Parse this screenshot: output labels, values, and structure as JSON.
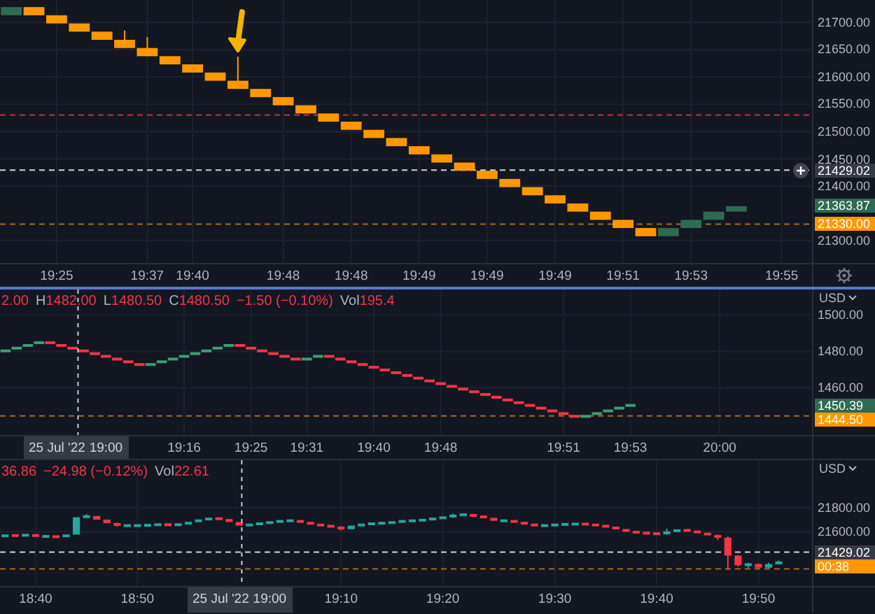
{
  "panes": [
    {
      "settings_button": true,
      "price_tags": [
        {
          "label": "21429.02",
          "color": "#363a45",
          "button": true
        },
        {
          "label": "21363.87",
          "color": "#2e6b52"
        },
        {
          "label": "21330.00",
          "color": "#ff9800"
        }
      ],
      "arrow": true,
      "chart_data": {
        "type": "candlestick",
        "grid": true,
        "ylim": [
          21259,
          21741
        ],
        "yticks": [
          {
            "value": 21700,
            "label": "21700.00"
          },
          {
            "value": 21650,
            "label": "21650.00"
          },
          {
            "value": 21600,
            "label": "21600.00"
          },
          {
            "value": 21550,
            "label": "21550.00"
          },
          {
            "value": 21500,
            "label": "21500.00"
          },
          {
            "value": 21450,
            "label": "21450.00"
          },
          {
            "value": 21400,
            "label": "21400.00"
          },
          {
            "value": 21300,
            "label": "21300.00"
          }
        ],
        "categories": [
          null,
          null,
          "19:25",
          null,
          null,
          null,
          "19:37",
          null,
          "19:40",
          null,
          null,
          null,
          "19:48",
          null,
          null,
          "19:48",
          null,
          null,
          "19:49",
          null,
          null,
          "19:49",
          null,
          null,
          "19:49",
          null,
          null,
          "19:51",
          null,
          null,
          "19:53",
          null,
          null,
          null,
          "19:55"
        ],
        "ohlc": [
          [
            21713,
            21728,
            21713,
            21728
          ],
          [
            21728,
            21728,
            21713,
            21713
          ],
          [
            21713,
            21713,
            21698,
            21698
          ],
          [
            21698,
            21698,
            21683,
            21683
          ],
          [
            21683,
            21683,
            21668,
            21668
          ],
          [
            21668,
            21685,
            21653,
            21653
          ],
          [
            21653,
            21673,
            21638,
            21638
          ],
          [
            21638,
            21638,
            21623,
            21623
          ],
          [
            21623,
            21623,
            21608,
            21608
          ],
          [
            21608,
            21608,
            21593,
            21593
          ],
          [
            21593,
            21637,
            21578,
            21578
          ],
          [
            21578,
            21578,
            21563,
            21563
          ],
          [
            21563,
            21563,
            21548,
            21548
          ],
          [
            21548,
            21548,
            21533,
            21533
          ],
          [
            21533,
            21533,
            21518,
            21518
          ],
          [
            21518,
            21518,
            21503,
            21503
          ],
          [
            21503,
            21503,
            21488,
            21488
          ],
          [
            21488,
            21488,
            21473,
            21473
          ],
          [
            21473,
            21473,
            21458,
            21458
          ],
          [
            21458,
            21458,
            21443,
            21443
          ],
          [
            21443,
            21443,
            21428,
            21428
          ],
          [
            21428,
            21428,
            21413,
            21413
          ],
          [
            21413,
            21413,
            21398,
            21398
          ],
          [
            21398,
            21398,
            21383,
            21383
          ],
          [
            21383,
            21383,
            21368,
            21368
          ],
          [
            21368,
            21368,
            21353,
            21353
          ],
          [
            21353,
            21353,
            21338,
            21338
          ],
          [
            21338,
            21338,
            21323,
            21323
          ],
          [
            21323,
            21323,
            21308,
            21308
          ],
          [
            21308,
            21323,
            21308,
            21323
          ],
          [
            21323,
            21338,
            21323,
            21338
          ],
          [
            21338,
            21353,
            21338,
            21353
          ],
          [
            21353,
            21363,
            21353,
            21363
          ],
          null,
          null
        ],
        "ref_lines": [
          {
            "axis": "y",
            "value": 21530,
            "color": "#b33a3a"
          },
          {
            "axis": "y",
            "value": 21429.02,
            "color": "#d1d4dc"
          },
          {
            "axis": "y",
            "value": 21330,
            "color": "#a86a1e"
          }
        ]
      }
    },
    {
      "legend": [
        {
          "value": "2.00"
        },
        {
          "label": "H",
          "value": "1482.00"
        },
        {
          "label": "L",
          "value": "1480.50"
        },
        {
          "label": "C",
          "value": "1480.50"
        },
        {
          "value": "−1.50 (−0.10%)"
        },
        {
          "label": "Vol",
          "value": "195.4"
        }
      ],
      "currency": "USD",
      "price_tags": [
        {
          "label": "1450.39",
          "color": "#2e6b52"
        },
        {
          "label": "1444.50",
          "color": "#ff9800"
        }
      ],
      "chart_data": {
        "type": "candlestick",
        "grid": true,
        "ylim": [
          1434,
          1514
        ],
        "yticks": [
          {
            "value": 1500,
            "label": "1500.00"
          },
          {
            "value": 1480,
            "label": "1480.00"
          },
          {
            "value": 1460,
            "label": "1460.00"
          }
        ],
        "categories": [
          null,
          null,
          null,
          null,
          null,
          null,
          null,
          null,
          null,
          null,
          null,
          null,
          null,
          null,
          null,
          null,
          "19:16",
          null,
          null,
          null,
          null,
          null,
          "19:25",
          null,
          null,
          null,
          null,
          "19:31",
          null,
          null,
          null,
          null,
          null,
          "19:40",
          null,
          null,
          null,
          null,
          null,
          "19:48",
          null,
          null,
          null,
          null,
          null,
          null,
          null,
          null,
          null,
          null,
          "19:51",
          null,
          null,
          null,
          null,
          null,
          "19:53",
          null,
          null,
          null,
          null,
          null,
          null,
          null,
          "20:00",
          null,
          null,
          null,
          null,
          null,
          null,
          null
        ],
        "ohlc": [
          [
            1479.5,
            1481,
            1479.5,
            1481
          ],
          [
            1481,
            1482.5,
            1481,
            1482.5
          ],
          [
            1482.5,
            1484,
            1482.5,
            1484
          ],
          [
            1484,
            1485.5,
            1484,
            1485.5
          ],
          [
            1485.5,
            1485.5,
            1484,
            1484
          ],
          [
            1484,
            1484,
            1482.5,
            1482.5
          ],
          [
            1482.5,
            1482.5,
            1481,
            1481
          ],
          [
            1481,
            1481,
            1479.5,
            1479.5
          ],
          [
            1479.5,
            1479.5,
            1478,
            1478
          ],
          [
            1478,
            1478,
            1476.5,
            1476.5
          ],
          [
            1476.5,
            1476.5,
            1475,
            1475
          ],
          [
            1475,
            1475,
            1473.5,
            1473.5
          ],
          [
            1473.5,
            1473.5,
            1472,
            1472
          ],
          [
            1472,
            1473.5,
            1472,
            1473.5
          ],
          [
            1473.5,
            1475,
            1473.5,
            1475
          ],
          [
            1475,
            1476.5,
            1475,
            1476.5
          ],
          [
            1476.5,
            1478,
            1476.5,
            1478
          ],
          [
            1478,
            1479.5,
            1478,
            1479.5
          ],
          [
            1479.5,
            1481,
            1479.5,
            1481
          ],
          [
            1481,
            1482.5,
            1481,
            1482.5
          ],
          [
            1482.5,
            1484,
            1482.5,
            1484
          ],
          [
            1484,
            1484,
            1482.5,
            1482.5
          ],
          [
            1482.5,
            1482.5,
            1481,
            1481
          ],
          [
            1481,
            1481,
            1479.5,
            1479.5
          ],
          [
            1479.5,
            1479.5,
            1478,
            1478
          ],
          [
            1478,
            1478,
            1476.5,
            1476.5
          ],
          [
            1476.5,
            1476.5,
            1475,
            1475
          ],
          [
            1475,
            1476.5,
            1475,
            1476.5
          ],
          [
            1476.5,
            1478,
            1476.5,
            1478
          ],
          [
            1478,
            1478,
            1476.5,
            1476.5
          ],
          [
            1476.5,
            1476.5,
            1475,
            1475
          ],
          [
            1475,
            1475,
            1473.5,
            1473.5
          ],
          [
            1473.5,
            1473.5,
            1472,
            1472
          ],
          [
            1472,
            1472,
            1470.5,
            1470.5
          ],
          [
            1470.5,
            1470.5,
            1469,
            1469
          ],
          [
            1469,
            1469,
            1467.5,
            1467.5
          ],
          [
            1467.5,
            1467.5,
            1466,
            1466
          ],
          [
            1466,
            1466,
            1464.5,
            1464.5
          ],
          [
            1464.5,
            1464.5,
            1463,
            1463
          ],
          [
            1463,
            1463,
            1461.5,
            1461.5
          ],
          [
            1461.5,
            1461.5,
            1460,
            1460
          ],
          [
            1460,
            1460,
            1458.5,
            1458.5
          ],
          [
            1458.5,
            1458.5,
            1457,
            1457
          ],
          [
            1457,
            1457,
            1455.5,
            1455.5
          ],
          [
            1455.5,
            1455.5,
            1454,
            1454
          ],
          [
            1454,
            1454,
            1452.5,
            1452.5
          ],
          [
            1452.5,
            1452.5,
            1451,
            1451
          ],
          [
            1451,
            1451,
            1449.5,
            1449.5
          ],
          [
            1449.5,
            1449.5,
            1448,
            1448
          ],
          [
            1448,
            1448,
            1446.5,
            1446.5
          ],
          [
            1446.5,
            1446.5,
            1445,
            1445
          ],
          [
            1445,
            1445,
            1443.5,
            1443.5
          ],
          [
            1443.5,
            1445,
            1443.5,
            1445
          ],
          [
            1445,
            1446.5,
            1445,
            1446.5
          ],
          [
            1446.5,
            1448,
            1446.5,
            1448
          ],
          [
            1448,
            1449.5,
            1448,
            1449.5
          ],
          [
            1449.5,
            1451,
            1449.5,
            1451
          ],
          null,
          null,
          null,
          null,
          null,
          null,
          null,
          null,
          null,
          null,
          null,
          null,
          null,
          null,
          null
        ],
        "ref_lines": [
          {
            "axis": "y",
            "value": 1444.5,
            "color": "#a86a1e"
          }
        ]
      },
      "crosshair": {
        "date": "25 Jul '22",
        "time": "19:00"
      }
    },
    {
      "legend": [
        {
          "value": "36.86"
        },
        {
          "value": "−24.98 (−0.12%)"
        },
        {
          "label": "Vol",
          "value": "22.61"
        }
      ],
      "currency": "USD",
      "price_tags": [
        {
          "label": "21429.02",
          "color": "#363a45"
        },
        {
          "label": "00:38",
          "color": "#ff9800"
        }
      ],
      "chart_data": {
        "type": "candlestick",
        "grid": true,
        "ylim": [
          21147,
          22195
        ],
        "yticks": [
          {
            "value": 21800,
            "label": "21800.00"
          },
          {
            "value": 21600,
            "label": "21600.00"
          }
        ],
        "categories": [
          null,
          null,
          null,
          "18:40",
          null,
          null,
          null,
          null,
          null,
          null,
          null,
          null,
          null,
          "18:50",
          null,
          null,
          null,
          null,
          null,
          null,
          null,
          null,
          null,
          null,
          null,
          null,
          null,
          null,
          null,
          null,
          null,
          null,
          null,
          "19:10",
          null,
          null,
          null,
          null,
          null,
          null,
          null,
          null,
          null,
          "19:20",
          null,
          null,
          null,
          null,
          null,
          null,
          null,
          null,
          null,
          null,
          "19:30",
          null,
          null,
          null,
          null,
          null,
          null,
          null,
          null,
          null,
          "19:40",
          null,
          null,
          null,
          null,
          null,
          null,
          null,
          null,
          null,
          "19:50",
          null,
          null,
          null,
          null
        ],
        "ohlc": [
          [
            21560,
            21580,
            21550,
            21570
          ],
          [
            21570,
            21575,
            21560,
            21565
          ],
          [
            21565,
            21580,
            21560,
            21575
          ],
          [
            21575,
            21580,
            21555,
            21560
          ],
          [
            21560,
            21565,
            21555,
            21560
          ],
          [
            21560,
            21565,
            21550,
            21555
          ],
          [
            21555,
            21580,
            21550,
            21575
          ],
          [
            21575,
            21725,
            21570,
            21720
          ],
          [
            21720,
            21745,
            21715,
            21730
          ],
          [
            21730,
            21735,
            21695,
            21700
          ],
          [
            21700,
            21705,
            21665,
            21670
          ],
          [
            21670,
            21675,
            21640,
            21650
          ],
          [
            21650,
            21655,
            21645,
            21650
          ],
          [
            21650,
            21655,
            21645,
            21650
          ],
          [
            21650,
            21660,
            21645,
            21655
          ],
          [
            21655,
            21665,
            21650,
            21660
          ],
          [
            21660,
            21665,
            21650,
            21655
          ],
          [
            21655,
            21665,
            21650,
            21660
          ],
          [
            21660,
            21685,
            21655,
            21680
          ],
          [
            21680,
            21705,
            21675,
            21700
          ],
          [
            21700,
            21715,
            21695,
            21710
          ],
          [
            21710,
            21715,
            21700,
            21705
          ],
          [
            21705,
            21710,
            21675,
            21680
          ],
          [
            21680,
            21685,
            21645,
            21650
          ],
          [
            21650,
            21665,
            21645,
            21660
          ],
          [
            21660,
            21675,
            21655,
            21670
          ],
          [
            21670,
            21685,
            21665,
            21680
          ],
          [
            21680,
            21695,
            21675,
            21690
          ],
          [
            21690,
            21695,
            21685,
            21690
          ],
          [
            21690,
            21695,
            21675,
            21680
          ],
          [
            21680,
            21685,
            21655,
            21660
          ],
          [
            21660,
            21665,
            21645,
            21650
          ],
          [
            21650,
            21655,
            21635,
            21640
          ],
          [
            21640,
            21645,
            21610,
            21620
          ],
          [
            21620,
            21655,
            21615,
            21650
          ],
          [
            21650,
            21665,
            21645,
            21660
          ],
          [
            21660,
            21675,
            21655,
            21670
          ],
          [
            21670,
            21675,
            21665,
            21670
          ],
          [
            21670,
            21685,
            21665,
            21680
          ],
          [
            21680,
            21695,
            21675,
            21690
          ],
          [
            21690,
            21695,
            21685,
            21690
          ],
          [
            21690,
            21705,
            21685,
            21700
          ],
          [
            21700,
            21715,
            21695,
            21710
          ],
          [
            21710,
            21725,
            21705,
            21720
          ],
          [
            21720,
            21750,
            21715,
            21740
          ],
          [
            21740,
            21745,
            21735,
            21740
          ],
          [
            21740,
            21745,
            21725,
            21730
          ],
          [
            21730,
            21735,
            21710,
            21715
          ],
          [
            21715,
            21720,
            21685,
            21690
          ],
          [
            21690,
            21695,
            21685,
            21690
          ],
          [
            21690,
            21695,
            21675,
            21680
          ],
          [
            21680,
            21685,
            21655,
            21660
          ],
          [
            21660,
            21665,
            21645,
            21650
          ],
          [
            21650,
            21655,
            21645,
            21650
          ],
          [
            21650,
            21665,
            21645,
            21660
          ],
          [
            21660,
            21665,
            21655,
            21660
          ],
          [
            21660,
            21670,
            21655,
            21665
          ],
          [
            21665,
            21670,
            21655,
            21660
          ],
          [
            21660,
            21665,
            21645,
            21650
          ],
          [
            21650,
            21655,
            21635,
            21640
          ],
          [
            21640,
            21645,
            21615,
            21620
          ],
          [
            21620,
            21625,
            21595,
            21600
          ],
          [
            21600,
            21605,
            21585,
            21590
          ],
          [
            21590,
            21595,
            21580,
            21585
          ],
          [
            21585,
            21590,
            21575,
            21580
          ],
          [
            21580,
            21625,
            21575,
            21600
          ],
          [
            21600,
            21620,
            21595,
            21615
          ],
          [
            21615,
            21620,
            21600,
            21605
          ],
          [
            21605,
            21610,
            21585,
            21590
          ],
          [
            21590,
            21595,
            21565,
            21570
          ],
          [
            21570,
            21575,
            21530,
            21550
          ],
          [
            21550,
            21560,
            21280,
            21400
          ],
          [
            21400,
            21405,
            21310,
            21320
          ],
          [
            21320,
            21340,
            21300,
            21330
          ],
          [
            21330,
            21335,
            21290,
            21300
          ],
          [
            21300,
            21340,
            21295,
            21330
          ],
          [
            21330,
            21360,
            21325,
            21350
          ],
          null,
          null
        ],
        "ref_lines": [
          {
            "axis": "y",
            "value": 21429.02,
            "color": "#d1d4dc"
          },
          {
            "axis": "y",
            "value": 21290,
            "color": "#a86a1e"
          }
        ]
      },
      "crosshair": {
        "date": "25 Jul '22",
        "time": "19:00"
      }
    }
  ]
}
